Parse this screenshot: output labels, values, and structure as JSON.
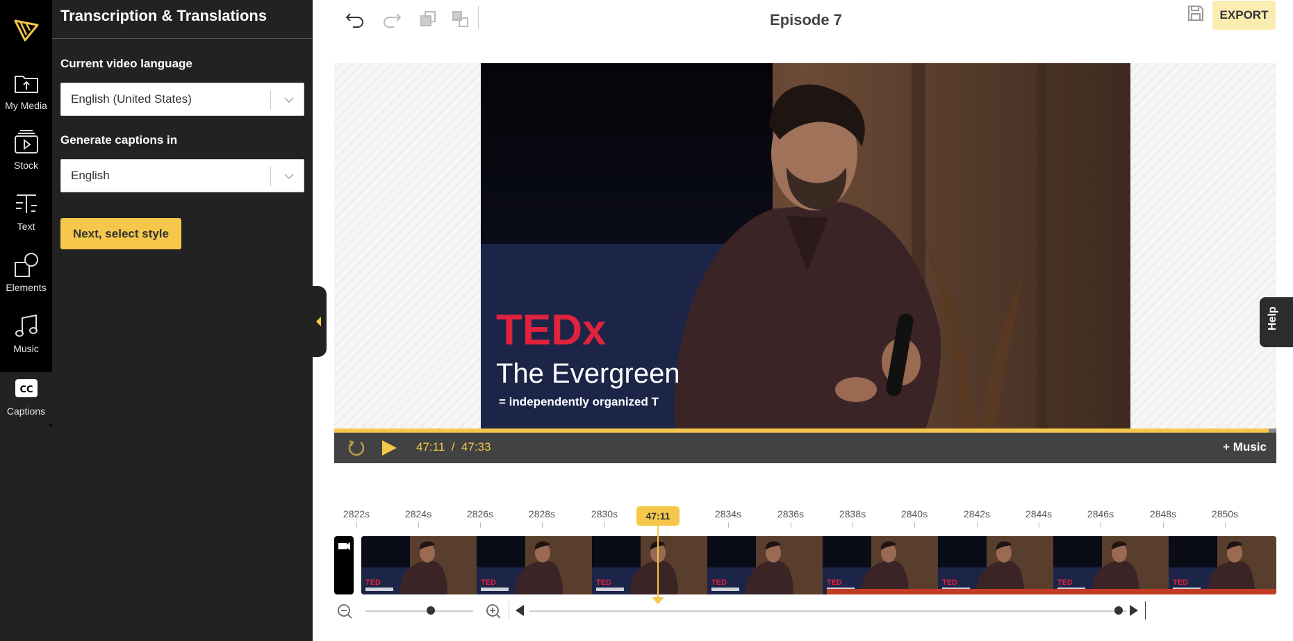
{
  "rail": {
    "items": [
      {
        "label": "My Media",
        "icon": "folder-upload-icon"
      },
      {
        "label": "Stock",
        "icon": "stock-video-icon"
      },
      {
        "label": "Text",
        "icon": "text-icon"
      },
      {
        "label": "Elements",
        "icon": "shapes-icon"
      },
      {
        "label": "Music",
        "icon": "music-note-icon"
      },
      {
        "label": "Captions",
        "icon": "cc-icon",
        "active": true
      }
    ]
  },
  "panel": {
    "title": "Transcription & Translations",
    "video_language_label": "Current video language",
    "video_language_value": "English (United States)",
    "captions_language_label": "Generate captions in",
    "captions_language_value": "English",
    "next_button": "Next, select style"
  },
  "header": {
    "title": "Episode 7",
    "export_label": "EXPORT"
  },
  "video": {
    "overlay_brand": "TEDx",
    "overlay_event": "The Evergreen",
    "overlay_note": "= independently organized T"
  },
  "player": {
    "current_time": "47:11",
    "separator": "/",
    "duration": "47:33",
    "progress": 0.992,
    "music_label": "+ Music"
  },
  "help_label": "Help",
  "timeline": {
    "ticks": [
      "2822s",
      "2824s",
      "2826s",
      "2828s",
      "2830s",
      "2834s",
      "2836s",
      "2838s",
      "2840s",
      "2842s",
      "2844s",
      "2846s",
      "2848s",
      "2850s"
    ],
    "marker_label": "47:11"
  },
  "colors": {
    "accent": "#f5c74a",
    "rail_bg": "#000000",
    "panel_bg": "#222222",
    "player_bar": "#424242"
  }
}
